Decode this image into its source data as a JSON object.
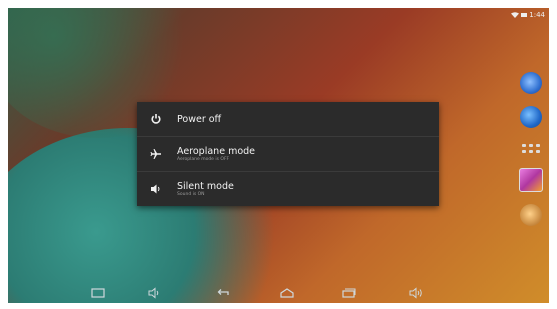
{
  "status_bar": {
    "time": "1:44"
  },
  "power_menu": {
    "items": [
      {
        "icon": "power-icon",
        "title": "Power off",
        "subtitle": ""
      },
      {
        "icon": "airplane-icon",
        "title": "Aeroplane mode",
        "subtitle": "Aeroplane mode is OFF"
      },
      {
        "icon": "volume-icon",
        "title": "Silent mode",
        "subtitle": "Sound is ON"
      }
    ]
  },
  "home_icons": [
    "app-icon-1",
    "app-icon-2",
    "all-apps-icon",
    "gallery-icon",
    "app-icon-5"
  ],
  "nav_bar": [
    "screenshot-icon",
    "volume-down-icon",
    "back-icon",
    "home-icon",
    "recents-icon",
    "volume-up-icon"
  ],
  "colors": {
    "menu_bg": "#2b2b2b",
    "menu_text": "#f2f2f2",
    "menu_subtext": "#9a9a9a"
  }
}
